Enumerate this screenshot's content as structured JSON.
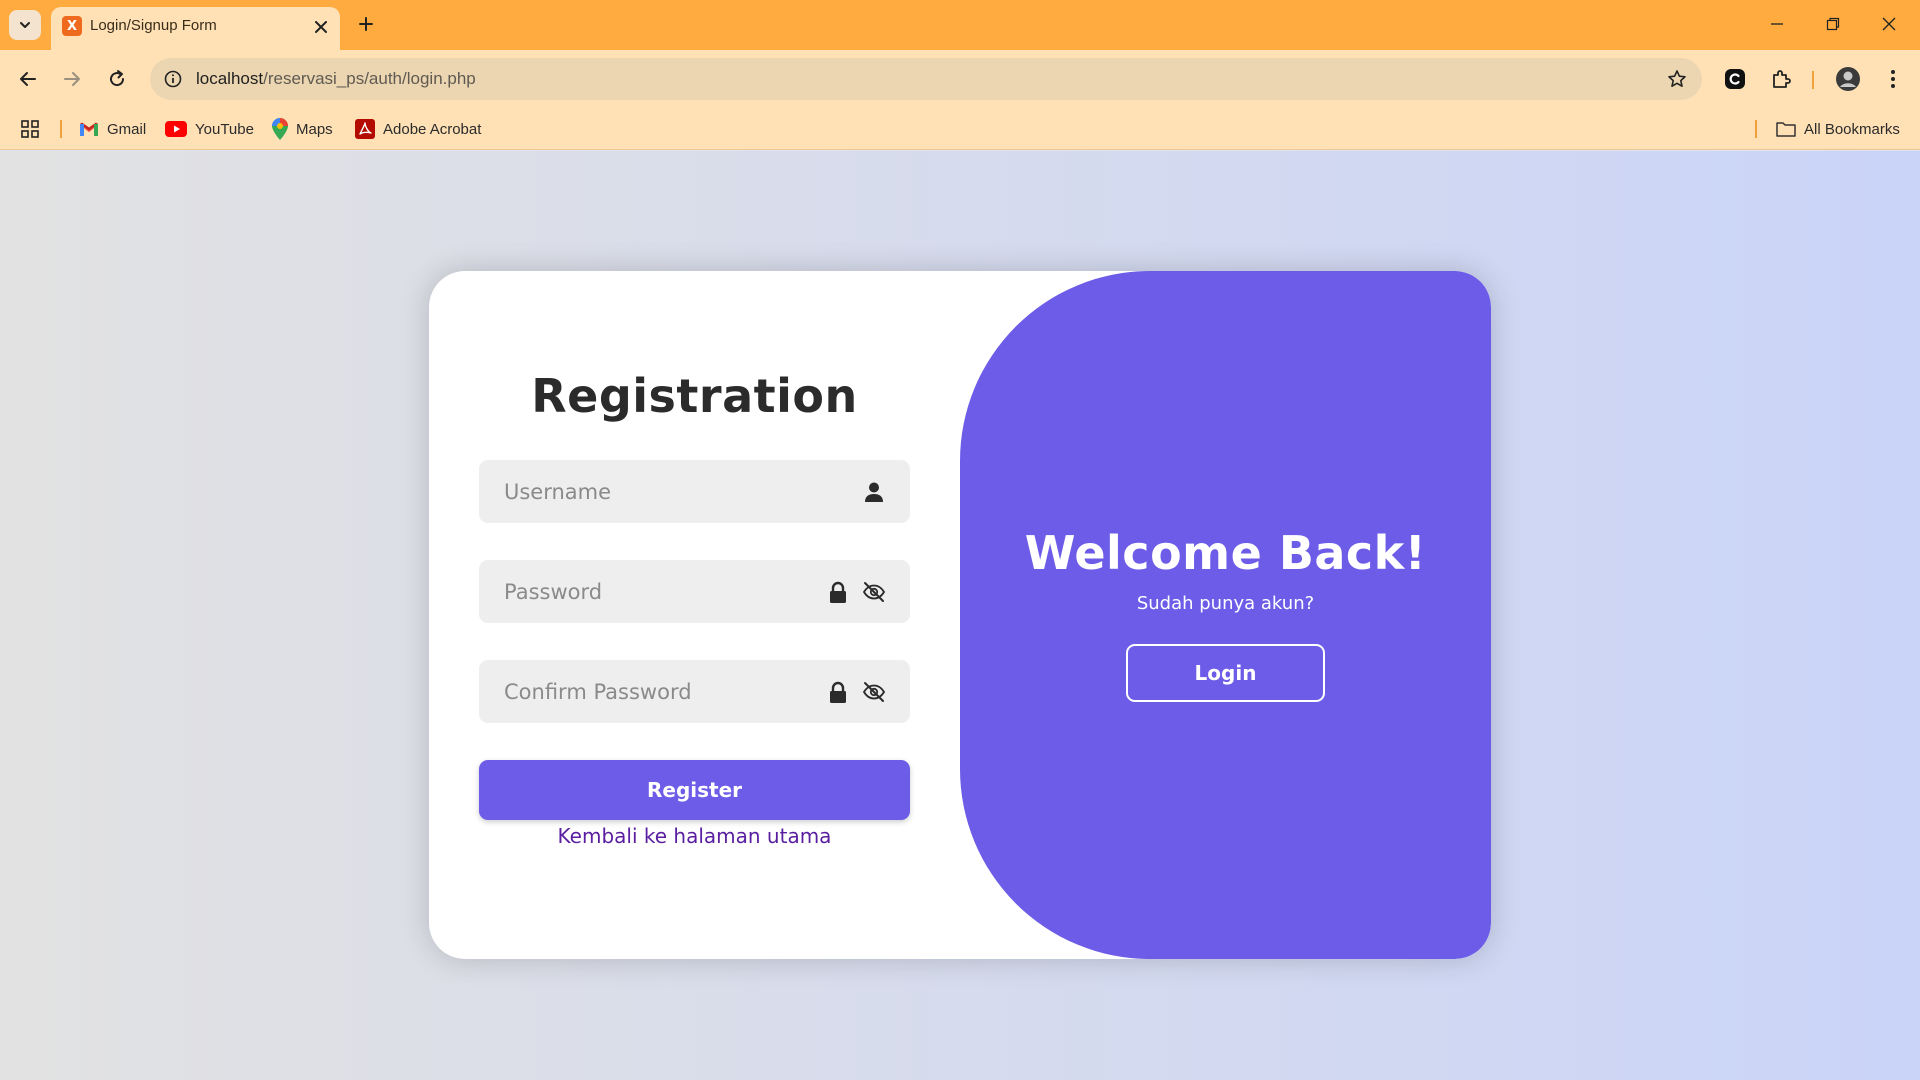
{
  "browser": {
    "tab_title": "Login/Signup Form",
    "favicon_text": "X",
    "url_host": "localhost",
    "url_path": "/reservasi_ps/auth/login.php",
    "bookmarks": [
      {
        "label": "Gmail",
        "icon": "gmail-icon"
      },
      {
        "label": "YouTube",
        "icon": "youtube-icon"
      },
      {
        "label": "Maps",
        "icon": "maps-icon"
      },
      {
        "label": "Adobe Acrobat",
        "icon": "adobe-acrobat-icon"
      }
    ],
    "all_bookmarks_label": "All Bookmarks",
    "colors": {
      "tabbar": "#ffab40",
      "toolbar": "#ffe1b5"
    }
  },
  "registration": {
    "title": "Registration",
    "username_placeholder": "Username",
    "password_placeholder": "Password",
    "confirm_password_placeholder": "Confirm Password",
    "register_label": "Register",
    "back_link": "Kembali ke halaman utama"
  },
  "welcome_panel": {
    "title": "Welcome Back!",
    "subtitle": "Sudah punya akun?",
    "login_label": "Login"
  },
  "colors": {
    "accent": "#6c5ce7",
    "link": "#5a1fa0",
    "card": "#ffffff"
  }
}
